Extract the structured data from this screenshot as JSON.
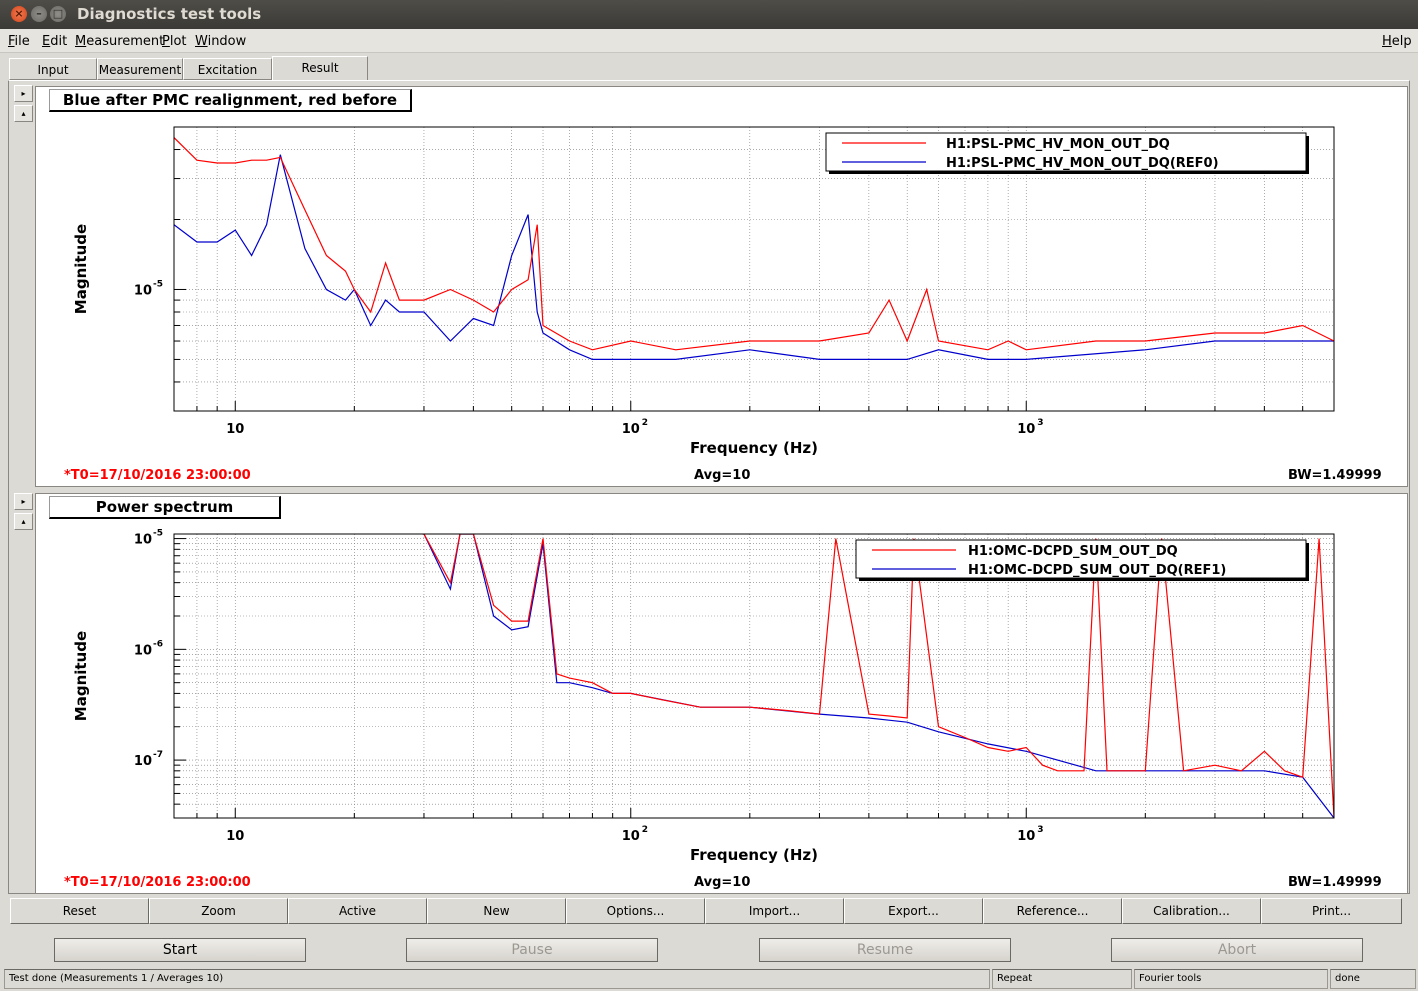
{
  "window": {
    "title": "Diagnostics test tools"
  },
  "menu": {
    "file": "File",
    "edit": "Edit",
    "measurement": "Measurement",
    "plot": "Plot",
    "window": "Window",
    "help": "Help"
  },
  "tabs": [
    "Input",
    "Measurement",
    "Excitation",
    "Result"
  ],
  "side_buttons": {
    "next": "▸",
    "up": "▴"
  },
  "plots": [
    {
      "title": "Blue after PMC realignment, red before",
      "ylabel": "Magnitude",
      "xlabel": "Frequency (Hz)",
      "xticks": [
        "10",
        "10",
        "10"
      ],
      "xtick_exp": [
        "",
        "2",
        "3"
      ],
      "yticks": [
        "10"
      ],
      "ytick_exp": [
        "-5"
      ],
      "legend": [
        "H1:PSL-PMC_HV_MON_OUT_DQ",
        "H1:PSL-PMC_HV_MON_OUT_DQ(REF0)"
      ],
      "t0": "*T0=17/10/2016 23:00:00",
      "avg": "Avg=10",
      "bw": "BW=1.49999"
    },
    {
      "title": "Power spectrum",
      "ylabel": "Magnitude",
      "xlabel": "Frequency (Hz)",
      "xticks": [
        "10",
        "10",
        "10"
      ],
      "xtick_exp": [
        "",
        "2",
        "3"
      ],
      "yticks": [
        "10",
        "10",
        "10"
      ],
      "ytick_exp": [
        "-5",
        "-6",
        "-7"
      ],
      "legend": [
        "H1:OMC-DCPD_SUM_OUT_DQ",
        "H1:OMC-DCPD_SUM_OUT_DQ(REF1)"
      ],
      "t0": "*T0=17/10/2016 23:00:00",
      "avg": "Avg=10",
      "bw": "BW=1.49999"
    }
  ],
  "colors": {
    "red_trace": "#ff0000",
    "blue_trace": "#0000cc",
    "t0_text": "#ff0000"
  },
  "chart_data": [
    {
      "type": "line",
      "title": "Blue after PMC realignment, red before",
      "xlabel": "Frequency (Hz)",
      "ylabel": "Magnitude",
      "xscale": "log",
      "yscale": "log",
      "xlim": [
        7,
        6000
      ],
      "ylim": [
        3e-06,
        5e-05
      ],
      "grid": true,
      "legend_position": "top-right",
      "series": [
        {
          "name": "H1:PSL-PMC_HV_MON_OUT_DQ",
          "color": "#ff0000",
          "x": [
            7,
            8,
            9,
            10,
            11,
            12,
            13,
            15,
            17,
            19,
            20,
            22,
            24,
            26,
            30,
            35,
            40,
            45,
            50,
            55,
            58,
            60,
            70,
            80,
            100,
            130,
            200,
            300,
            400,
            450,
            500,
            560,
            600,
            800,
            900,
            1000,
            1500,
            2000,
            3000,
            4000,
            5000,
            6000
          ],
          "y": [
            4.5e-05,
            3.6e-05,
            3.5e-05,
            3.5e-05,
            3.6e-05,
            3.6e-05,
            3.7e-05,
            2.2e-05,
            1.4e-05,
            1.2e-05,
            1e-05,
            8e-06,
            1.3e-05,
            9e-06,
            9e-06,
            1e-05,
            9e-06,
            8e-06,
            1e-05,
            1.1e-05,
            1.9e-05,
            7e-06,
            6e-06,
            5.5e-06,
            6e-06,
            5.5e-06,
            6e-06,
            6e-06,
            6.5e-06,
            9e-06,
            6e-06,
            1e-05,
            6e-06,
            5.5e-06,
            6e-06,
            5.5e-06,
            6e-06,
            6e-06,
            6.5e-06,
            6.5e-06,
            7e-06,
            6e-06
          ]
        },
        {
          "name": "H1:PSL-PMC_HV_MON_OUT_DQ(REF0)",
          "color": "#0000cc",
          "x": [
            7,
            8,
            9,
            10,
            11,
            12,
            13,
            15,
            17,
            19,
            20,
            22,
            24,
            26,
            30,
            35,
            40,
            45,
            50,
            55,
            58,
            60,
            70,
            80,
            100,
            130,
            200,
            300,
            400,
            500,
            600,
            800,
            1000,
            2000,
            3000,
            6000
          ],
          "y": [
            1.9e-05,
            1.6e-05,
            1.6e-05,
            1.8e-05,
            1.4e-05,
            1.9e-05,
            3.8e-05,
            1.5e-05,
            1e-05,
            9e-06,
            1e-05,
            7e-06,
            9e-06,
            8e-06,
            8e-06,
            6e-06,
            7.5e-06,
            7e-06,
            1.4e-05,
            2.1e-05,
            8e-06,
            6.5e-06,
            5.5e-06,
            5e-06,
            5e-06,
            5e-06,
            5.5e-06,
            5e-06,
            5e-06,
            5e-06,
            5.5e-06,
            5e-06,
            5e-06,
            5.5e-06,
            6e-06,
            6e-06
          ]
        }
      ]
    },
    {
      "type": "line",
      "title": "Power spectrum",
      "xlabel": "Frequency (Hz)",
      "ylabel": "Magnitude",
      "xscale": "log",
      "yscale": "log",
      "xlim": [
        7,
        6000
      ],
      "ylim": [
        3e-08,
        1.1e-05
      ],
      "grid": true,
      "legend_position": "top-right",
      "series": [
        {
          "name": "H1:OMC-DCPD_SUM_OUT_DQ",
          "color": "#ff0000",
          "x": [
            20,
            30,
            35,
            37,
            40,
            45,
            50,
            55,
            60,
            65,
            70,
            80,
            90,
            100,
            120,
            150,
            200,
            250,
            300,
            330,
            400,
            450,
            500,
            520,
            600,
            700,
            800,
            900,
            1000,
            1100,
            1200,
            1400,
            1500,
            1600,
            2000,
            2200,
            2500,
            3000,
            3500,
            4000,
            4500,
            5000,
            5500,
            6000
          ],
          "y": [
            1.2e-05,
            1.1e-05,
            4e-06,
            1.1e-05,
            1.1e-05,
            2.5e-06,
            1.8e-06,
            1.8e-06,
            1e-05,
            6e-07,
            5.5e-07,
            5e-07,
            4e-07,
            4e-07,
            3.5e-07,
            3e-07,
            3e-07,
            2.8e-07,
            2.6e-07,
            1e-05,
            2.6e-07,
            2.5e-07,
            2.4e-07,
            1e-05,
            2e-07,
            1.6e-07,
            1.3e-07,
            1.2e-07,
            1.3e-07,
            9e-08,
            8e-08,
            8e-08,
            1e-05,
            8e-08,
            8e-08,
            1e-05,
            8e-08,
            9e-08,
            8e-08,
            1.2e-07,
            8e-08,
            7e-08,
            1e-05,
            3e-08
          ]
        },
        {
          "name": "H1:OMC-DCPD_SUM_OUT_DQ(REF1)",
          "color": "#0000cc",
          "x": [
            20,
            30,
            35,
            37,
            40,
            45,
            50,
            55,
            60,
            65,
            70,
            80,
            90,
            100,
            150,
            200,
            300,
            400,
            500,
            600,
            800,
            1000,
            1500,
            2000,
            3000,
            4000,
            5000,
            6000
          ],
          "y": [
            1.2e-05,
            1.1e-05,
            3.5e-06,
            1.1e-05,
            1.1e-05,
            2e-06,
            1.5e-06,
            1.6e-06,
            9e-06,
            5e-07,
            5e-07,
            4.5e-07,
            4e-07,
            4e-07,
            3e-07,
            3e-07,
            2.6e-07,
            2.4e-07,
            2.2e-07,
            1.8e-07,
            1.4e-07,
            1.2e-07,
            8e-08,
            8e-08,
            8e-08,
            8e-08,
            7e-08,
            3e-08
          ]
        }
      ]
    }
  ],
  "buttons": [
    "Reset",
    "Zoom",
    "Active",
    "New",
    "Options...",
    "Import...",
    "Export...",
    "Reference...",
    "Calibration...",
    "Print..."
  ],
  "controls": {
    "start": "Start",
    "pause": "Pause",
    "resume": "Resume",
    "abort": "Abort"
  },
  "status": {
    "main": "Test done (Measurements 1 / Averages 10)",
    "repeat": "Repeat",
    "tools": "Fourier tools",
    "state": "done"
  }
}
